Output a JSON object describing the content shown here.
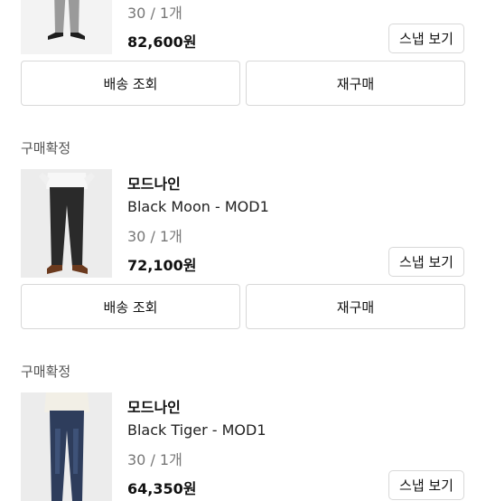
{
  "orders": [
    {
      "option": "30 / 1개",
      "price": "82,600원",
      "snap_label": "스냅 보기",
      "delivery_label": "배송 조회",
      "rebuy_label": "재구매"
    },
    {
      "status": "구매확정",
      "brand": "모드나인",
      "product": "Black Moon - MOD1",
      "option": "30 / 1개",
      "price": "72,100원",
      "snap_label": "스냅 보기",
      "delivery_label": "배송 조회",
      "rebuy_label": "재구매"
    },
    {
      "status": "구매확정",
      "brand": "모드나인",
      "product": "Black Tiger - MOD1",
      "option": "30 / 1개",
      "price": "64,350원",
      "snap_label": "스냅 보기"
    }
  ]
}
